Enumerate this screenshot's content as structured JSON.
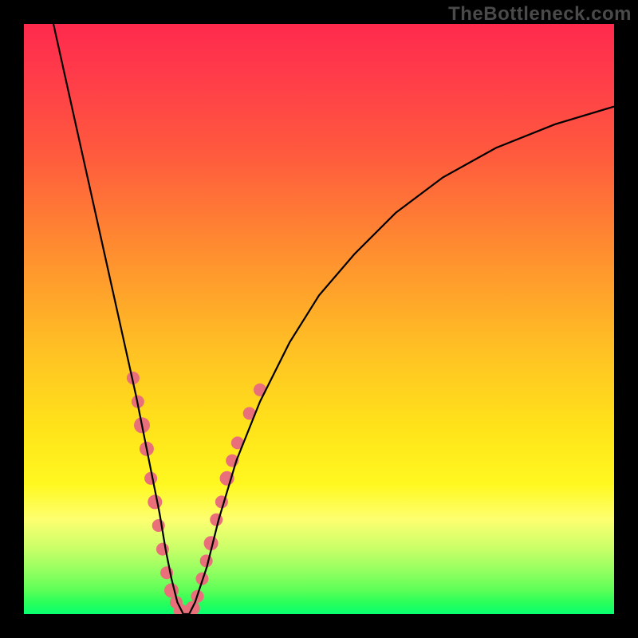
{
  "watermark": "TheBottleneck.com",
  "chart_data": {
    "type": "line",
    "title": "",
    "xlabel": "",
    "ylabel": "",
    "xlim": [
      0,
      100
    ],
    "ylim": [
      0,
      100
    ],
    "series": [
      {
        "name": "bottleneck-curve",
        "x": [
          5,
          7,
          9,
          11,
          13,
          15,
          17,
          19,
          21,
          22,
          23,
          24,
          25,
          26,
          27,
          28,
          29,
          31,
          33,
          36,
          40,
          45,
          50,
          56,
          63,
          71,
          80,
          90,
          100
        ],
        "values": [
          100,
          91,
          82,
          73,
          64,
          55,
          46,
          37,
          27,
          22,
          17,
          11,
          6,
          2,
          0,
          0,
          2,
          8,
          16,
          26,
          36,
          46,
          54,
          61,
          68,
          74,
          79,
          83,
          86
        ]
      }
    ],
    "markers": {
      "name": "highlight-points",
      "color": "#e96f7a",
      "points": [
        {
          "x": 18.5,
          "y": 40,
          "r": 8
        },
        {
          "x": 19.3,
          "y": 36,
          "r": 8
        },
        {
          "x": 20.0,
          "y": 32,
          "r": 10
        },
        {
          "x": 20.8,
          "y": 28,
          "r": 9
        },
        {
          "x": 21.5,
          "y": 23,
          "r": 8
        },
        {
          "x": 22.2,
          "y": 19,
          "r": 9
        },
        {
          "x": 22.8,
          "y": 15,
          "r": 8
        },
        {
          "x": 23.5,
          "y": 11,
          "r": 8
        },
        {
          "x": 24.2,
          "y": 7,
          "r": 8
        },
        {
          "x": 25.0,
          "y": 4,
          "r": 9
        },
        {
          "x": 25.8,
          "y": 2,
          "r": 8
        },
        {
          "x": 26.6,
          "y": 0.5,
          "r": 9
        },
        {
          "x": 27.6,
          "y": 0,
          "r": 10
        },
        {
          "x": 28.6,
          "y": 1,
          "r": 9
        },
        {
          "x": 29.4,
          "y": 3,
          "r": 8
        },
        {
          "x": 30.2,
          "y": 6,
          "r": 8
        },
        {
          "x": 30.9,
          "y": 9,
          "r": 8
        },
        {
          "x": 31.7,
          "y": 12,
          "r": 9
        },
        {
          "x": 32.6,
          "y": 16,
          "r": 8
        },
        {
          "x": 33.5,
          "y": 19,
          "r": 8
        },
        {
          "x": 34.4,
          "y": 23,
          "r": 9
        },
        {
          "x": 35.3,
          "y": 26,
          "r": 8
        },
        {
          "x": 36.2,
          "y": 29,
          "r": 8
        },
        {
          "x": 38.2,
          "y": 34,
          "r": 8
        },
        {
          "x": 40.0,
          "y": 38,
          "r": 8
        }
      ]
    }
  }
}
